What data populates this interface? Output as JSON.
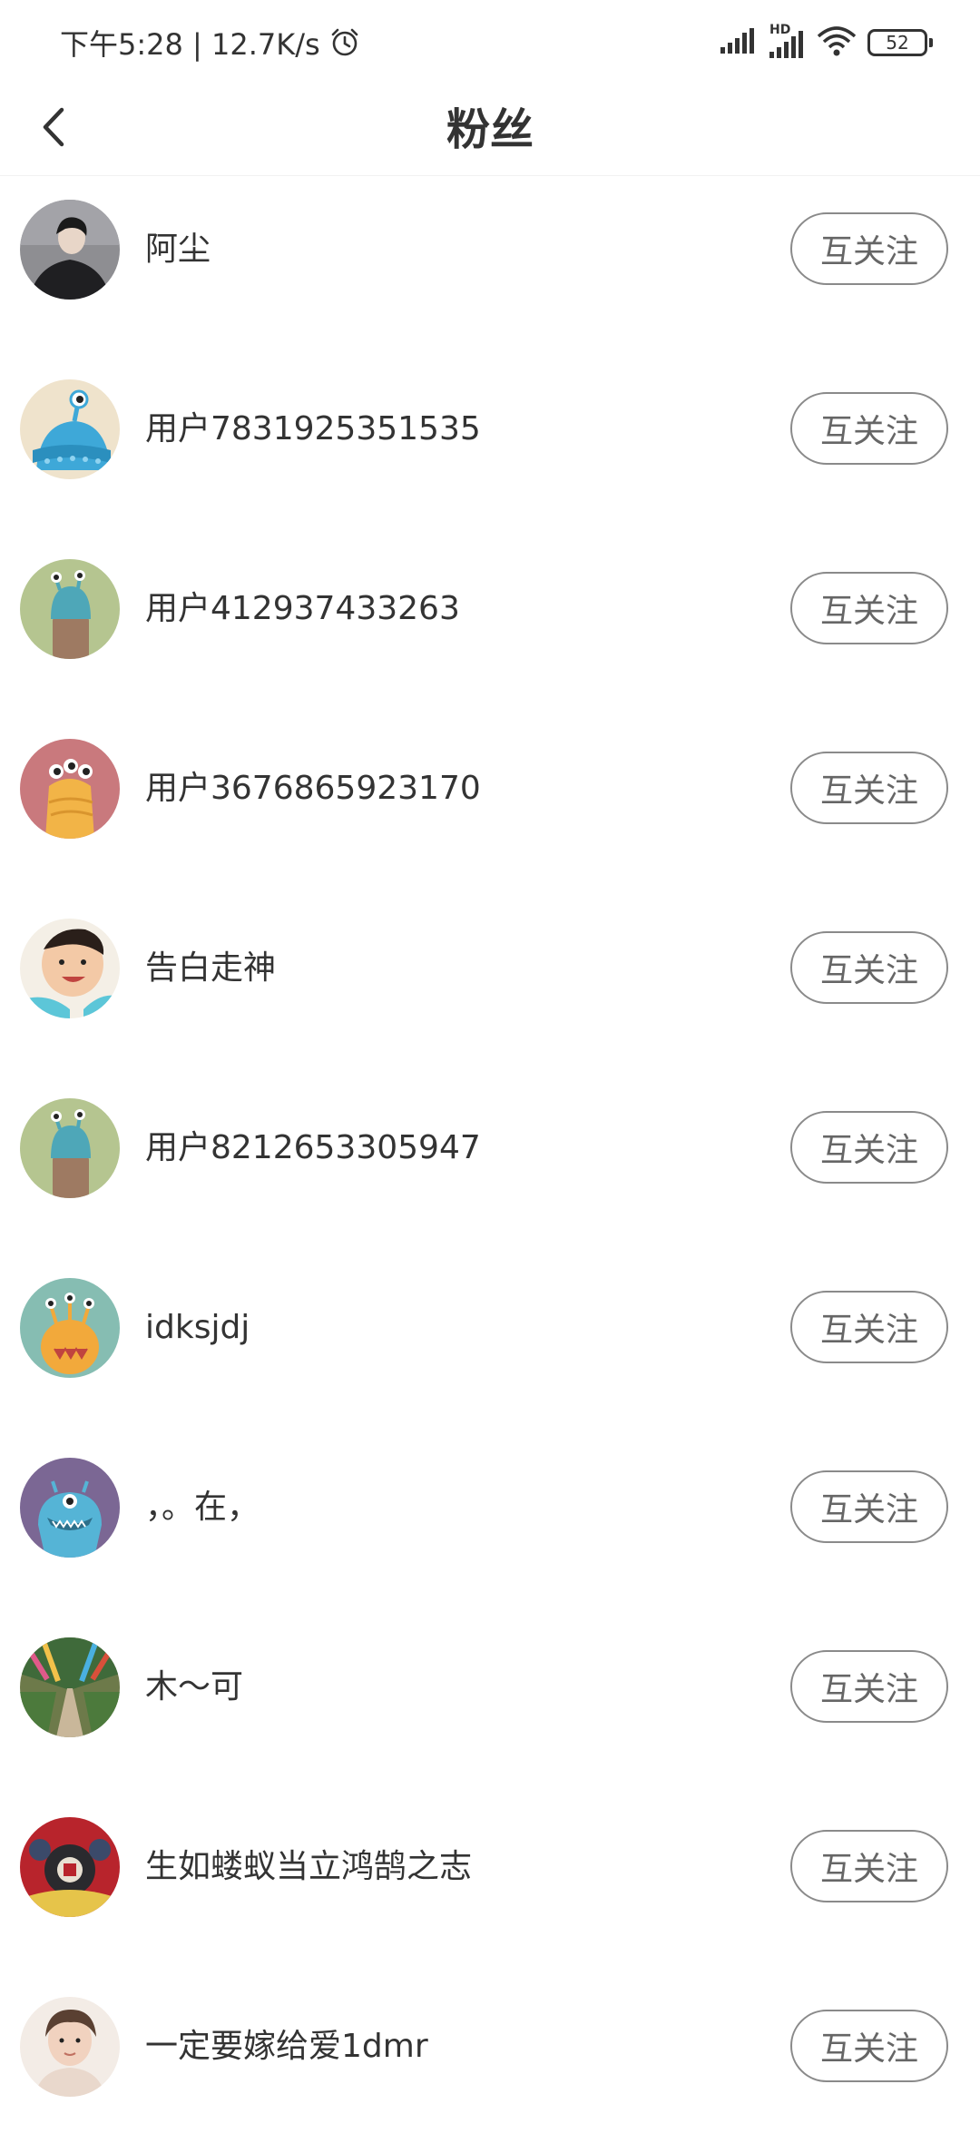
{
  "status_bar": {
    "time_speed": "下午5:28 | 12.7K/s",
    "signal1_icon": "signal-bars-icon",
    "hd_label": "HD",
    "signal2_icon": "signal-bars-hd-icon",
    "wifi_icon": "wifi-icon",
    "battery_level": "52"
  },
  "header": {
    "back_icon": "chevron-left-icon",
    "title": "粉丝"
  },
  "colors": {
    "text": "#333333",
    "button_border": "#8a8a8a",
    "button_text": "#666666",
    "background": "#ffffff"
  },
  "fans": [
    {
      "name": "阿尘",
      "button": "互关注",
      "avatar": "photo-man-avatar"
    },
    {
      "name": "用户7831925351535",
      "button": "互关注",
      "avatar": "blue-monster-avatar"
    },
    {
      "name": "用户412937433263",
      "button": "互关注",
      "avatar": "green-monster-avatar"
    },
    {
      "name": "用户3676865923170",
      "button": "互关注",
      "avatar": "orange-monster-avatar"
    },
    {
      "name": "告白走神",
      "button": "互关注",
      "avatar": "photo-baby-avatar"
    },
    {
      "name": "用户8212653305947",
      "button": "互关注",
      "avatar": "green-monster-avatar"
    },
    {
      "name": "idksjdj",
      "button": "互关注",
      "avatar": "yellow-monster-avatar"
    },
    {
      "name": "，。在，",
      "button": "互关注",
      "avatar": "purple-monster-avatar"
    },
    {
      "name": "木～可",
      "button": "互关注",
      "avatar": "photo-street-avatar"
    },
    {
      "name": "生如蝼蚁当立鸿鹄之志",
      "button": "互关注",
      "avatar": "photo-red-avatar"
    },
    {
      "name": "一定要嫁给爱1dmr",
      "button": "互关注",
      "avatar": "photo-girl-avatar"
    }
  ]
}
